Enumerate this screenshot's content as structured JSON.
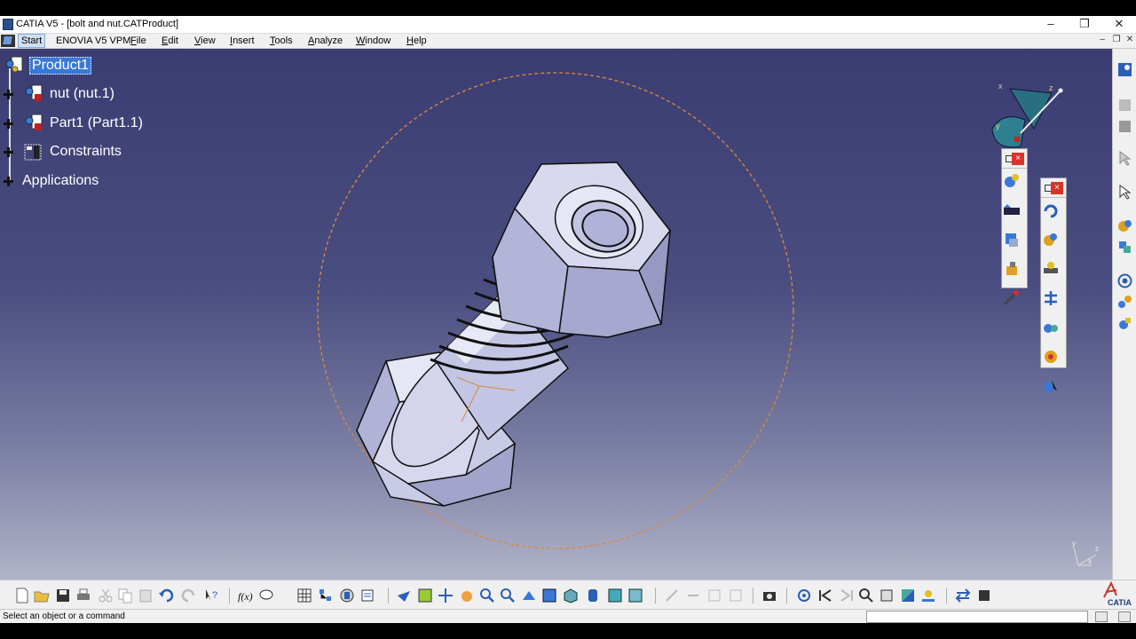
{
  "window": {
    "title": "CATIA V5 - [bolt and nut.CATProduct]",
    "controls": [
      "–",
      "❐",
      "✕"
    ],
    "mdi_controls": [
      "–",
      "❐",
      "✕"
    ]
  },
  "menu": {
    "items": [
      "Start",
      "ENOVIA V5 VPM",
      "File",
      "Edit",
      "View",
      "Insert",
      "Tools",
      "Analyze",
      "Window",
      "Help"
    ]
  },
  "tree": {
    "root": "Product1",
    "children": [
      "nut (nut.1)",
      "Part1 (Part1.1)",
      "Constraints",
      "Applications"
    ]
  },
  "compass_axes": [
    "x",
    "z",
    "y"
  ],
  "mini_axes": [
    "y",
    "z",
    "x"
  ],
  "status": {
    "text": "Select an object or a command"
  },
  "brand": {
    "logo_text": "CATIA",
    "accent_color": "#3a78d8",
    "viewport_top": "#3b3d72",
    "viewport_bottom": "#b1b3c8"
  }
}
